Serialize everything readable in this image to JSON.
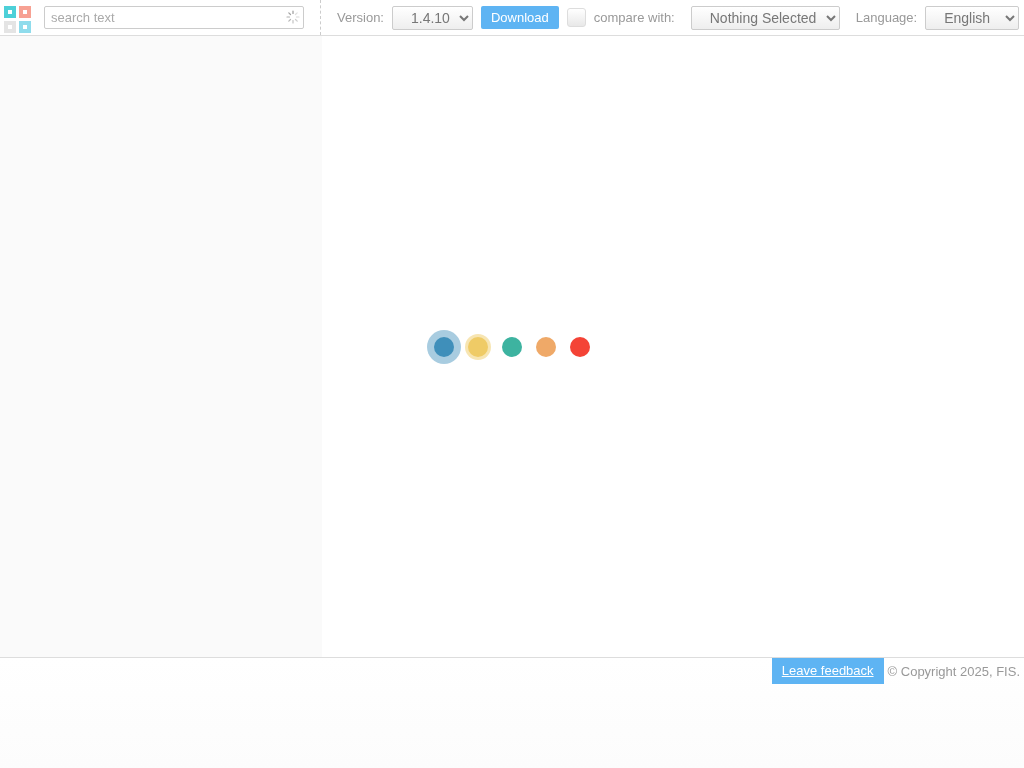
{
  "search": {
    "placeholder": "search text"
  },
  "version": {
    "label": "Version:",
    "value": "1.4.10"
  },
  "download_button": "Download",
  "compare": {
    "checked": false,
    "label": "compare with:",
    "value": "Nothing Selected"
  },
  "language": {
    "label": "Language:",
    "value": "English"
  },
  "loader_dots": [
    {
      "color": "#3f8fba",
      "selected": true
    },
    {
      "color": "#efcb66",
      "selected": false
    },
    {
      "color": "#3db3a0",
      "selected": false
    },
    {
      "color": "#efa968",
      "selected": false
    },
    {
      "color": "#f44336",
      "selected": false
    }
  ],
  "footer": {
    "link": "Leave feedback",
    "copyright": "© Copyright 2025, FIS."
  }
}
